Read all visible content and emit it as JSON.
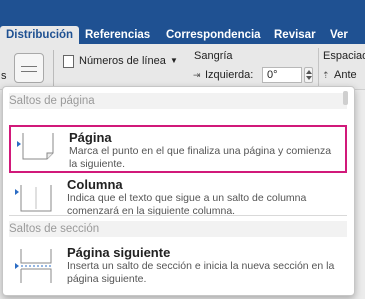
{
  "tabs": [
    {
      "label": "Distribución",
      "active": true
    },
    {
      "label": "Referencias"
    },
    {
      "label": "Correspondencia"
    },
    {
      "label": "Revisar"
    },
    {
      "label": "Ver"
    }
  ],
  "ribbon": {
    "line_numbers": "Números de línea",
    "indent_label": "Sangría",
    "left_label": "Izquierda:",
    "left_value": "0°",
    "spacing_label": "Espaciad",
    "before_label": "Ante",
    "s_label": "s"
  },
  "menu": {
    "page_breaks_header": "Saltos de página",
    "section_breaks_header": "Saltos de sección",
    "items": [
      {
        "title": "Página",
        "desc": "Marca el punto en el que finaliza una página y comienza la siguiente."
      },
      {
        "title": "Columna",
        "desc": "Indica que el texto que sigue a un salto de columna comenzará en la siguiente columna."
      },
      {
        "title": "Página siguiente",
        "desc": "Inserta un salto de sección e inicia la nueva sección en la página siguiente."
      }
    ]
  },
  "colors": {
    "tab_bar": "#1f5192",
    "selection_border": "#d1197a",
    "arrow_blue": "#2b6cc4"
  }
}
